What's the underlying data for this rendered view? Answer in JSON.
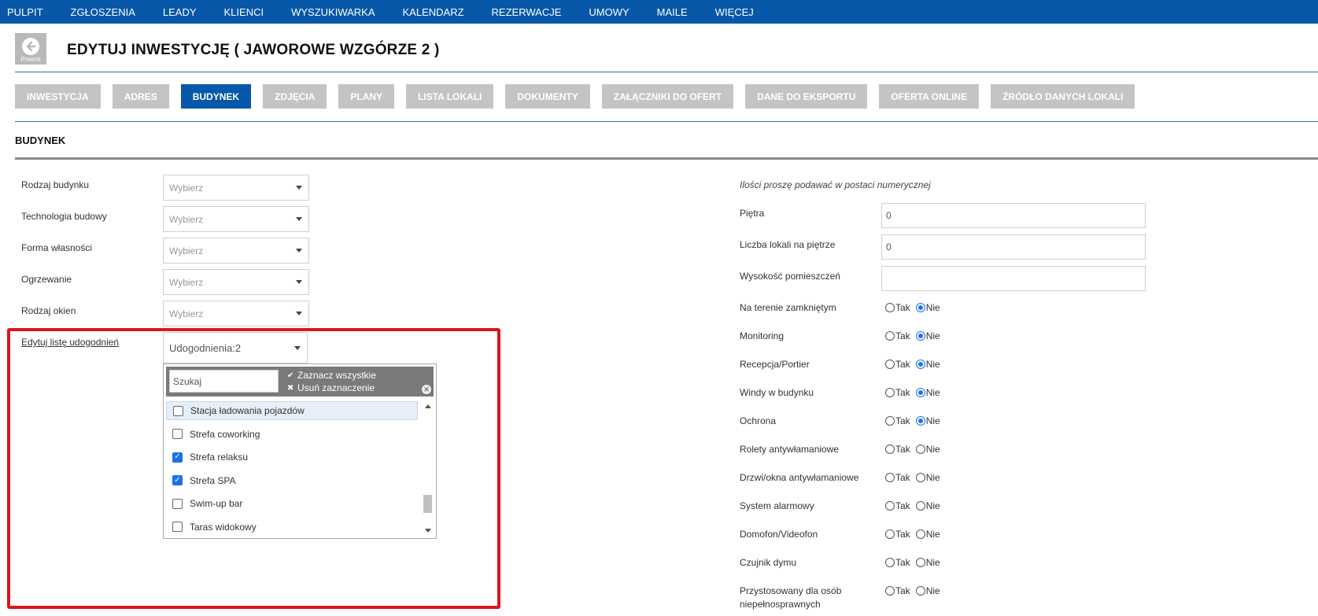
{
  "nav": [
    "PULPIT",
    "ZGŁOSZENIA",
    "LEADY",
    "KLIENCI",
    "WYSZUKIWARKA",
    "KALENDARZ",
    "REZERWACJE",
    "UMOWY",
    "MAILE",
    "WIĘCEJ"
  ],
  "header": {
    "back_label": "Powrót",
    "title": "EDYTUJ INWESTYCJĘ ( JAWOROWE WZGÓRZE 2 )"
  },
  "tabs": [
    "INWESTYCJA",
    "ADRES",
    "BUDYNEK",
    "ZDJĘCIA",
    "PLANY",
    "LISTA LOKALI",
    "DOKUMENTY",
    "ZAŁĄCZNIKI DO OFERT",
    "DANE DO EKSPORTU",
    "OFERTA ONLINE",
    "ŹRÓDŁO DANYCH LOKALI"
  ],
  "active_tab": "BUDYNEK",
  "section_title": "BUDYNEK",
  "left_fields": [
    {
      "label": "Rodzaj budynku",
      "value": "Wybierz"
    },
    {
      "label": "Technologia budowy",
      "value": "Wybierz"
    },
    {
      "label": "Forma własności",
      "value": "Wybierz"
    },
    {
      "label": "Ogrzewanie",
      "value": "Wybierz"
    },
    {
      "label": "Rodzaj okien",
      "value": "Wybierz"
    }
  ],
  "amenities": {
    "label": "Edytuj listę udogodnień",
    "value": "Udogodnienia:2",
    "search_placeholder": "Szukaj",
    "select_all": "Zaznacz wszystkie",
    "clear_selection": "Usuń zaznaczenie",
    "items": [
      {
        "label": "Stacja ładowania pojazdów",
        "checked": false
      },
      {
        "label": "Strefa coworking",
        "checked": false
      },
      {
        "label": "Strefa relaksu",
        "checked": true
      },
      {
        "label": "Strefa SPA",
        "checked": true
      },
      {
        "label": "Swim-up bar",
        "checked": false
      },
      {
        "label": "Taras widokowy",
        "checked": false
      }
    ]
  },
  "right": {
    "note": "Ilości proszę podawać w postaci numerycznej",
    "inputs": [
      {
        "label": "Piętra",
        "value": "0"
      },
      {
        "label": "Liczba lokali na piętrze",
        "value": "0"
      },
      {
        "label": "Wysokość pomieszczeń",
        "value": ""
      }
    ],
    "yes_label": "Tak",
    "no_label": "Nie",
    "radios": [
      {
        "label": "Na terenie zamkniętym",
        "selected": "Nie"
      },
      {
        "label": "Monitoring",
        "selected": "Nie"
      },
      {
        "label": "Recepcja/Portier",
        "selected": "Nie"
      },
      {
        "label": "Windy w budynku",
        "selected": "Nie"
      },
      {
        "label": "Ochrona",
        "selected": "Nie"
      },
      {
        "label": "Rolety antywłamaniowe",
        "selected": ""
      },
      {
        "label": "Drzwi/okna antywłamaniowe",
        "selected": ""
      },
      {
        "label": "System alarmowy",
        "selected": ""
      },
      {
        "label": "Domofon/Videofon",
        "selected": ""
      },
      {
        "label": "Czujnik dymu",
        "selected": ""
      },
      {
        "label": "Przystosowany dla osób niepełnosprawnych",
        "selected": ""
      }
    ]
  },
  "colors": {
    "nav_bg": "#0758a8",
    "tab_active": "#0758a8",
    "tab_inactive": "#c4c4c4",
    "highlight_border": "#e0141c",
    "radio_selected": "#1a73e8"
  }
}
